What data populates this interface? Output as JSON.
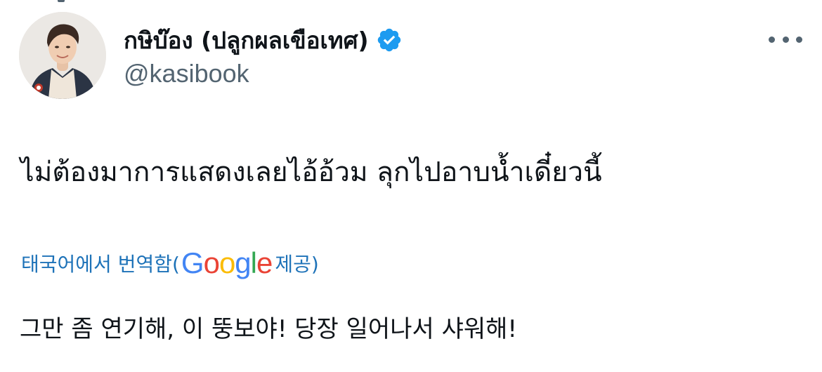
{
  "author": {
    "display_name": "กษิบ๊อง (ปลูกผลเขือเทศ)",
    "handle": "@kasibook",
    "verified": true,
    "avatar": "profile-photo"
  },
  "tweet": {
    "text": "ไม่ต้องมาการแสดงเลยไอ้อ้วม ลุกไปอาบน้ำเดี๋ยวนี้"
  },
  "translation": {
    "label_prefix": "태국어에서 번역함(",
    "provider_logo": [
      "G",
      "o",
      "o",
      "g",
      "l",
      "e"
    ],
    "provider_colors": [
      "#4285F4",
      "#EA4335",
      "#FBBC05",
      "#4285F4",
      "#34A853",
      "#EA4335"
    ],
    "label_suffix": " 제공)",
    "translated_text": "그만 좀 연기해, 이 뚱보야! 당장 일어나서 샤워해!"
  },
  "colors": {
    "link": "#1d72b8",
    "secondary_text": "#536471",
    "verified": "#1d9bf0"
  },
  "icons": {
    "more": "more-horizontal-icon",
    "verified": "verified-badge-icon"
  }
}
